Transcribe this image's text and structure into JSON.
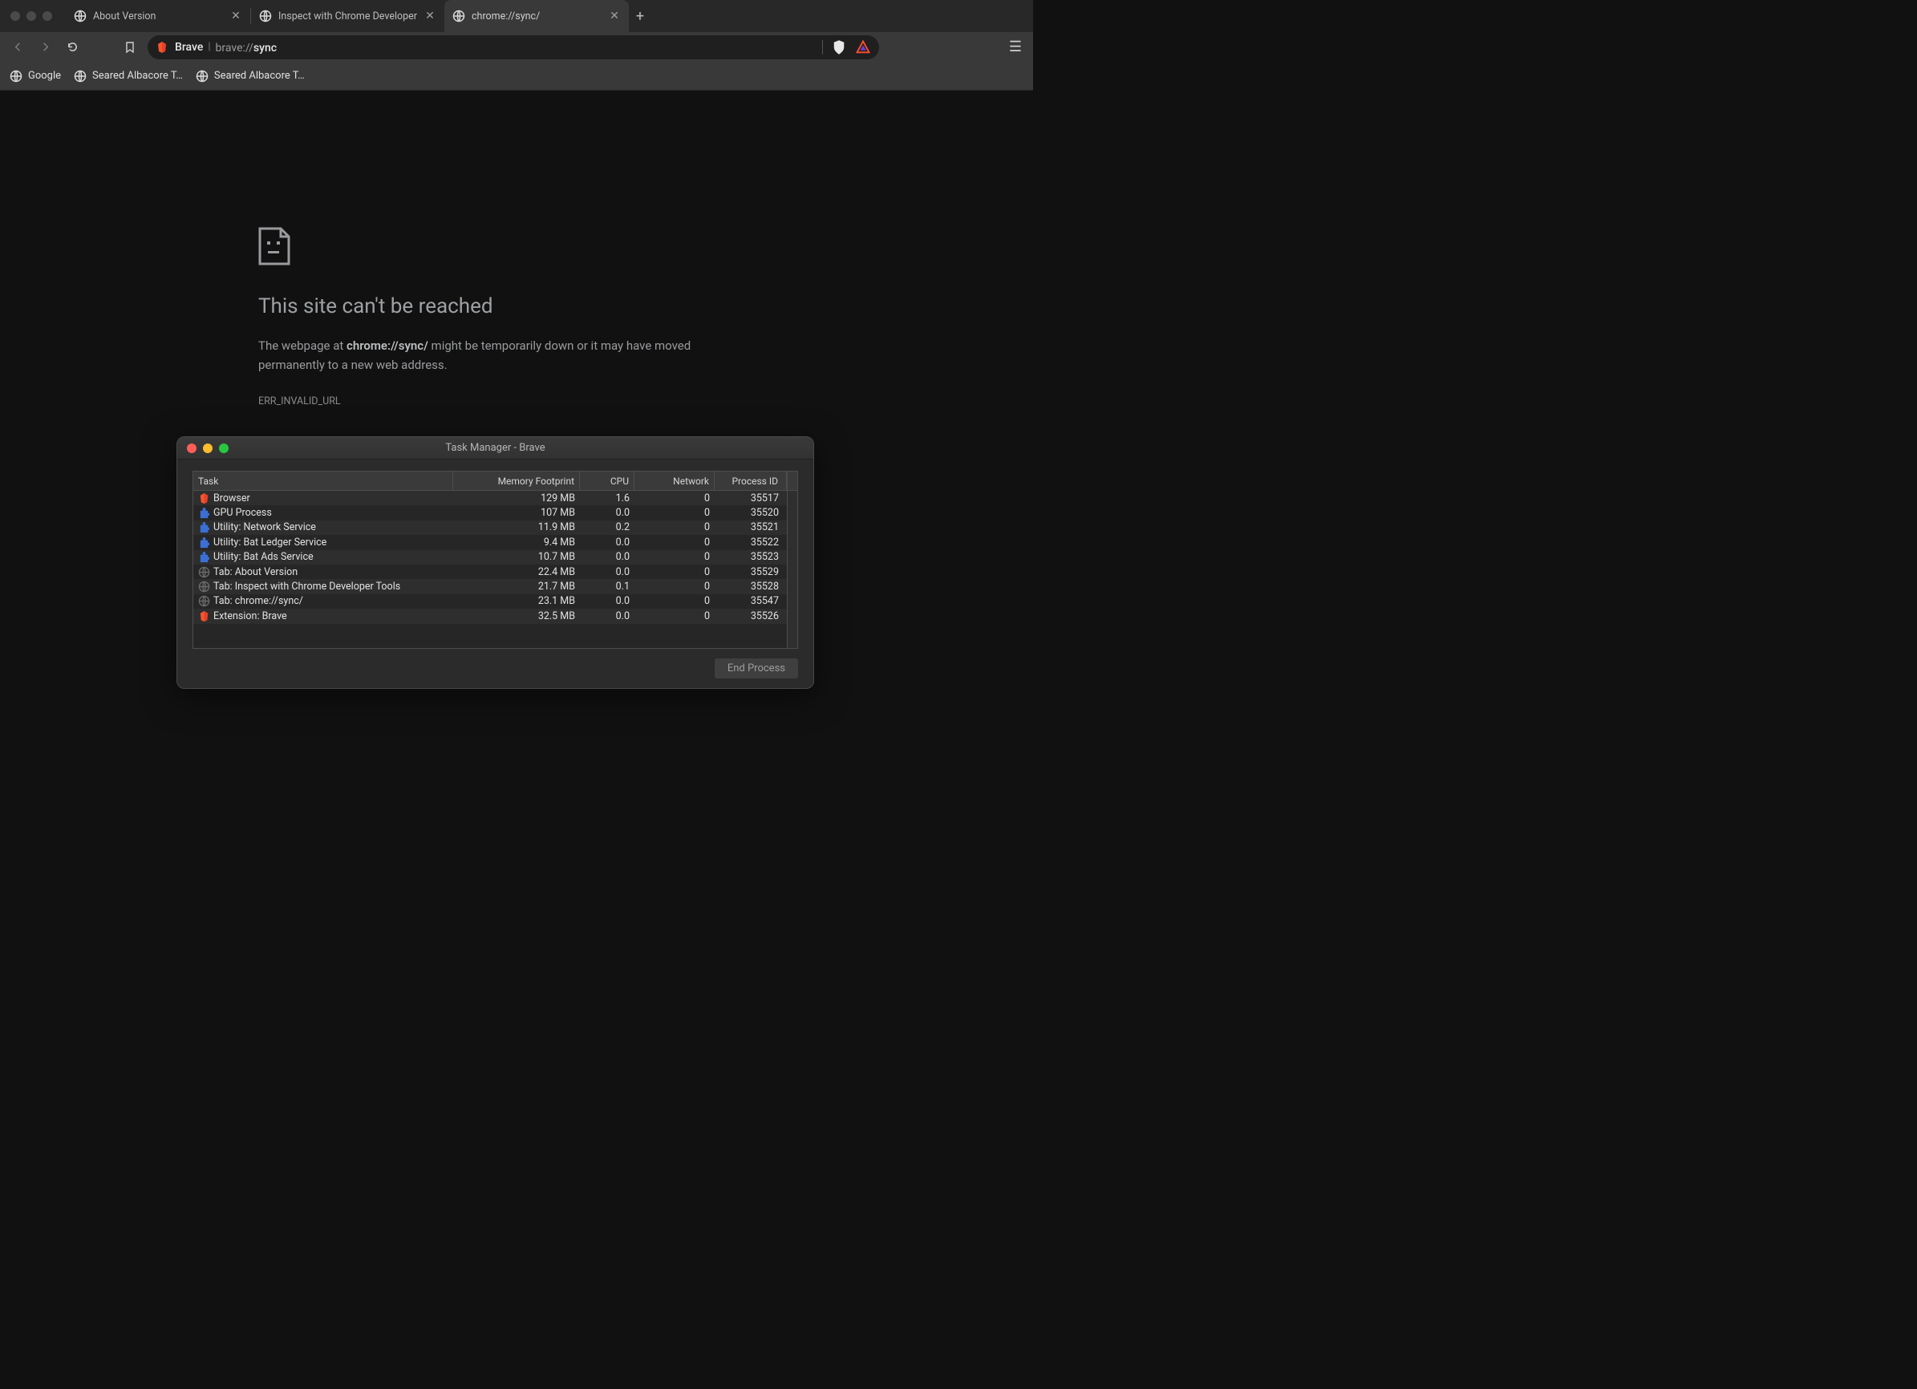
{
  "tabs": [
    {
      "title": "About Version",
      "active": false
    },
    {
      "title": "Inspect with Chrome Developer",
      "active": false
    },
    {
      "title": "chrome://sync/",
      "active": true
    }
  ],
  "omnibox": {
    "host": "Brave",
    "scheme": "brave://",
    "path": "sync"
  },
  "bookmarks": [
    {
      "label": "Google"
    },
    {
      "label": "Seared Albacore T…"
    },
    {
      "label": "Seared Albacore T…"
    }
  ],
  "error": {
    "title": "This site can't be reached",
    "msg_prefix": "The webpage at ",
    "msg_url": "chrome://sync/",
    "msg_suffix": " might be temporarily down or it may have moved permanently to a new web address.",
    "code": "ERR_INVALID_URL"
  },
  "task_manager": {
    "title": "Task Manager - Brave",
    "columns": {
      "task": "Task",
      "mem": "Memory Footprint",
      "cpu": "CPU",
      "net": "Network",
      "pid": "Process ID"
    },
    "end_button": "End Process",
    "rows": [
      {
        "icon": "brave",
        "name": "Browser",
        "mem": "129 MB",
        "cpu": "1.6",
        "net": "0",
        "pid": "35517"
      },
      {
        "icon": "puzzle",
        "name": "GPU Process",
        "mem": "107 MB",
        "cpu": "0.0",
        "net": "0",
        "pid": "35520"
      },
      {
        "icon": "puzzle",
        "name": "Utility: Network Service",
        "mem": "11.9 MB",
        "cpu": "0.2",
        "net": "0",
        "pid": "35521"
      },
      {
        "icon": "puzzle",
        "name": "Utility: Bat Ledger Service",
        "mem": "9.4 MB",
        "cpu": "0.0",
        "net": "0",
        "pid": "35522"
      },
      {
        "icon": "puzzle",
        "name": "Utility: Bat Ads Service",
        "mem": "10.7 MB",
        "cpu": "0.0",
        "net": "0",
        "pid": "35523"
      },
      {
        "icon": "globe",
        "name": "Tab: About Version",
        "mem": "22.4 MB",
        "cpu": "0.0",
        "net": "0",
        "pid": "35529"
      },
      {
        "icon": "globe",
        "name": "Tab: Inspect with Chrome Developer Tools",
        "mem": "21.7 MB",
        "cpu": "0.1",
        "net": "0",
        "pid": "35528"
      },
      {
        "icon": "globe",
        "name": "Tab: chrome://sync/",
        "mem": "23.1 MB",
        "cpu": "0.0",
        "net": "0",
        "pid": "35547"
      },
      {
        "icon": "brave",
        "name": "Extension: Brave",
        "mem": "32.5 MB",
        "cpu": "0.0",
        "net": "0",
        "pid": "35526"
      }
    ]
  }
}
